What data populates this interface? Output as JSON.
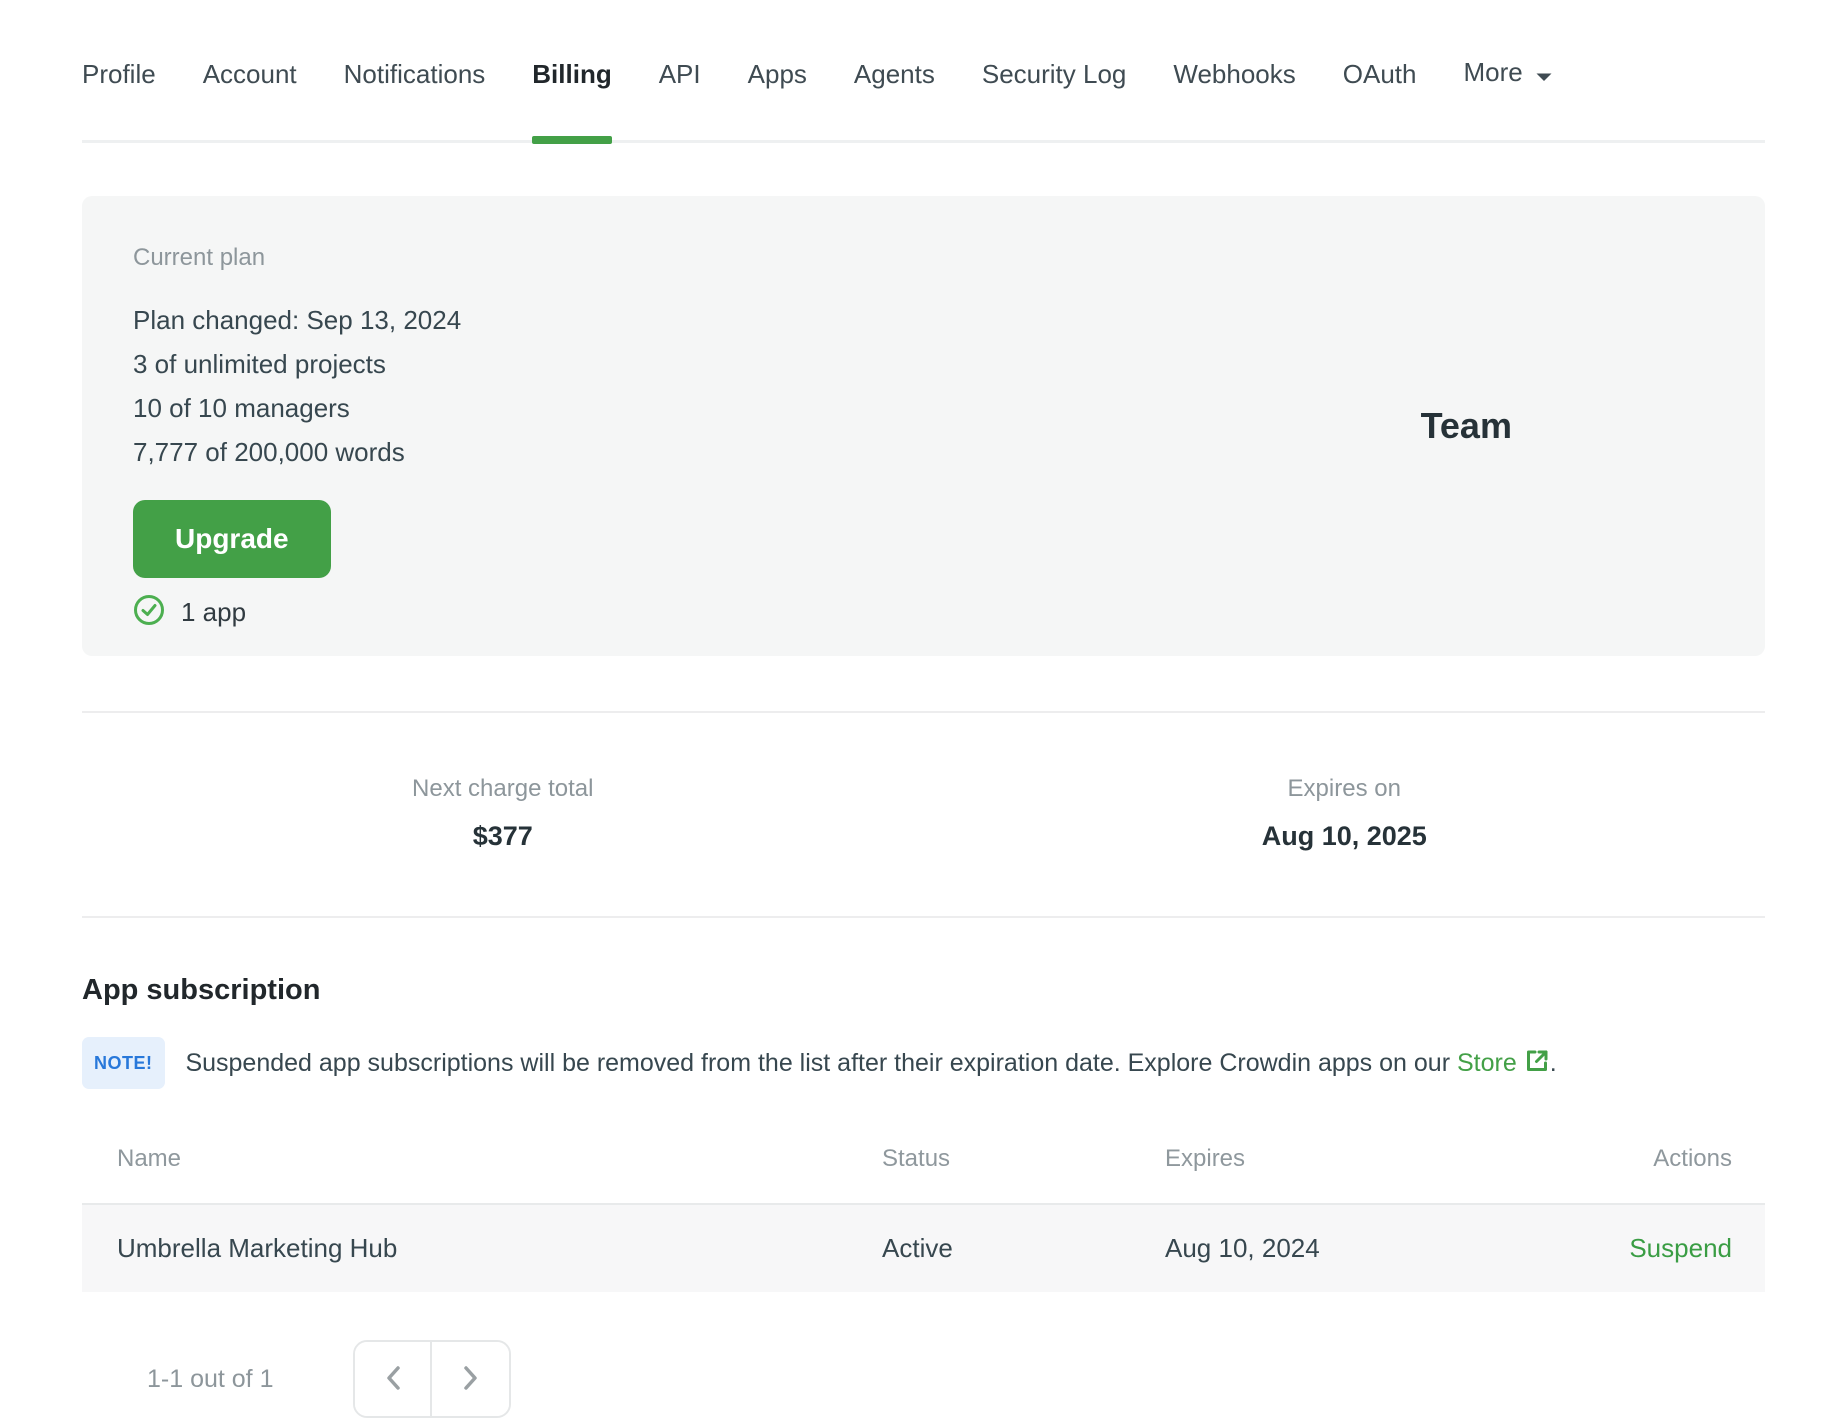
{
  "tabs": {
    "items": [
      {
        "label": "Profile"
      },
      {
        "label": "Account"
      },
      {
        "label": "Notifications"
      },
      {
        "label": "Billing",
        "active": true
      },
      {
        "label": "API"
      },
      {
        "label": "Apps"
      },
      {
        "label": "Agents"
      },
      {
        "label": "Security Log"
      },
      {
        "label": "Webhooks"
      },
      {
        "label": "OAuth"
      },
      {
        "label": "More",
        "has_caret": true
      }
    ]
  },
  "current_plan": {
    "label": "Current plan",
    "lines": [
      "Plan changed: Sep 13, 2024",
      "3 of unlimited projects",
      "10 of 10 managers",
      "7,777 of 200,000 words"
    ],
    "upgrade_label": "Upgrade",
    "apps_count": "1 app",
    "plan_name": "Team"
  },
  "billing_summary": {
    "next_charge": {
      "label": "Next charge total",
      "value": "$377"
    },
    "expires": {
      "label": "Expires on",
      "value": "Aug 10, 2025"
    }
  },
  "app_subscription": {
    "title": "App subscription",
    "note_badge": "NOTE!",
    "note_text": "Suspended app subscriptions will be removed from the list after their expiration date. Explore Crowdin apps on our",
    "note_link": "Store",
    "note_suffix": ".",
    "table": {
      "headers": {
        "name": "Name",
        "status": "Status",
        "expires": "Expires",
        "actions": "Actions"
      },
      "rows": [
        {
          "name": "Umbrella Marketing Hub",
          "status": "Active",
          "expires": "Aug 10, 2024",
          "action": "Suspend"
        }
      ]
    },
    "pagination": {
      "summary": "1-1 out of 1"
    }
  },
  "colors": {
    "accent_green": "#43a047",
    "suspend_green": "#3a9d44",
    "note_blue": "#2878da",
    "note_bg": "#e6f0fc",
    "card_bg": "#f5f6f6",
    "row_bg": "#f7f7f8"
  }
}
